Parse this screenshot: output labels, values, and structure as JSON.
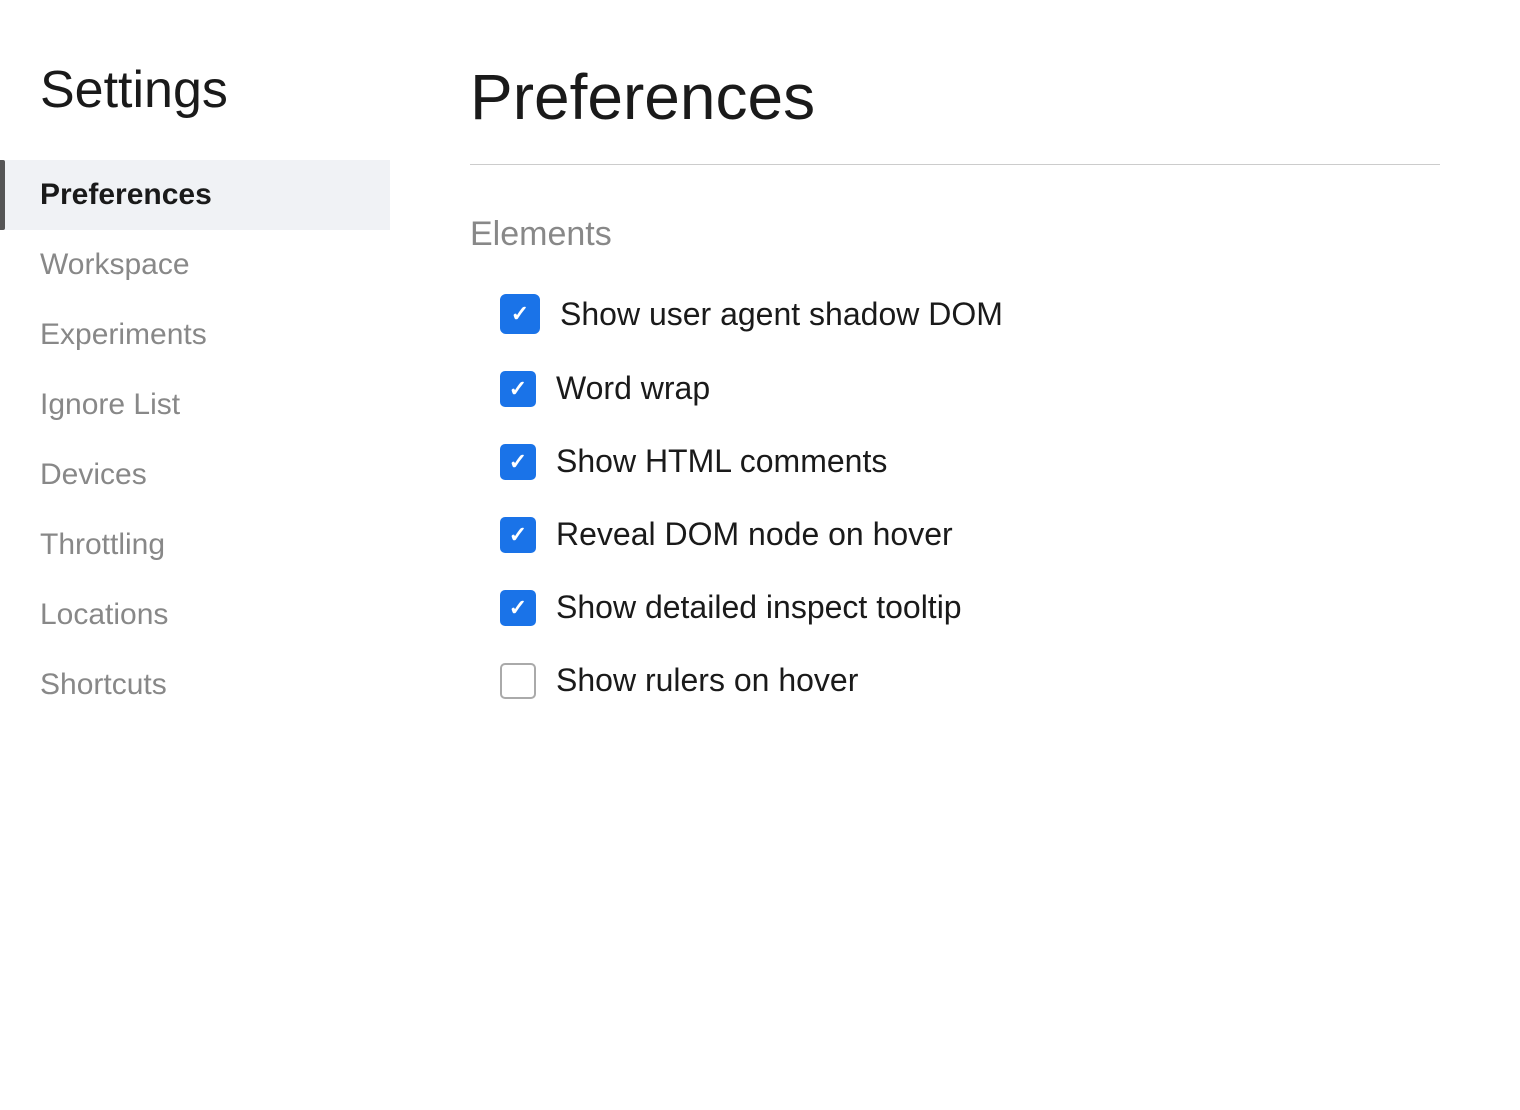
{
  "sidebar": {
    "title": "Settings",
    "nav_items": [
      {
        "id": "preferences",
        "label": "Preferences",
        "active": true
      },
      {
        "id": "workspace",
        "label": "Workspace",
        "active": false
      },
      {
        "id": "experiments",
        "label": "Experiments",
        "active": false
      },
      {
        "id": "ignore-list",
        "label": "Ignore List",
        "active": false
      },
      {
        "id": "devices",
        "label": "Devices",
        "active": false
      },
      {
        "id": "throttling",
        "label": "Throttling",
        "active": false
      },
      {
        "id": "locations",
        "label": "Locations",
        "active": false
      },
      {
        "id": "shortcuts",
        "label": "Shortcuts",
        "active": false
      }
    ]
  },
  "main": {
    "page_title": "Preferences",
    "sections": [
      {
        "id": "elements",
        "title": "Elements",
        "checkboxes": [
          {
            "id": "show-shadow-dom",
            "label": "Show user agent shadow DOM",
            "checked": true,
            "large": true
          },
          {
            "id": "word-wrap",
            "label": "Word wrap",
            "checked": true,
            "large": false
          },
          {
            "id": "show-html-comments",
            "label": "Show HTML comments",
            "checked": true,
            "large": false
          },
          {
            "id": "reveal-dom-node",
            "label": "Reveal DOM node on hover",
            "checked": true,
            "large": false
          },
          {
            "id": "show-inspect-tooltip",
            "label": "Show detailed inspect tooltip",
            "checked": true,
            "large": false
          },
          {
            "id": "show-rulers",
            "label": "Show rulers on hover",
            "checked": false,
            "large": false
          }
        ]
      }
    ]
  }
}
